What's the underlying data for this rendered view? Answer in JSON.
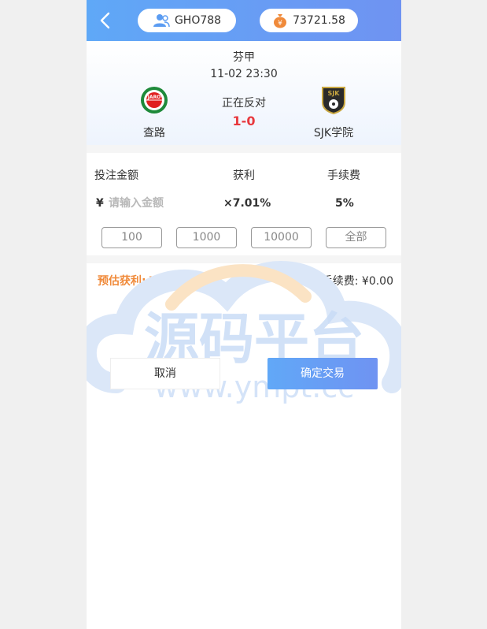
{
  "header": {
    "username": "GHO788",
    "balance": "73721.58",
    "balance_icon_glyph": "¥",
    "accent": "#6f93f2"
  },
  "match": {
    "league": "芬甲",
    "time": "11-02 23:30",
    "status": "正在反对",
    "score": "1-0",
    "home": {
      "name": "查路",
      "logo_text": "JARO"
    },
    "away": {
      "name": "SJK学院",
      "logo_text": "SJK"
    }
  },
  "bet": {
    "amount_label": "投注金额",
    "profit_label": "获利",
    "fee_label": "手续费",
    "currency": "¥",
    "amount_placeholder": "请输入金额",
    "rate": "×7.01%",
    "fee": "5%",
    "quick_amounts": [
      "100",
      "1000",
      "10000",
      "全部"
    ]
  },
  "summary": {
    "est_label": "预估获利:",
    "est_value": "¥0.00",
    "fee_label": "手续费:",
    "fee_value": "¥0.00"
  },
  "actions": {
    "cancel": "取消",
    "confirm": "确定交易"
  },
  "watermark": {
    "title": "源码平台",
    "url": "www.ympt.cc"
  }
}
